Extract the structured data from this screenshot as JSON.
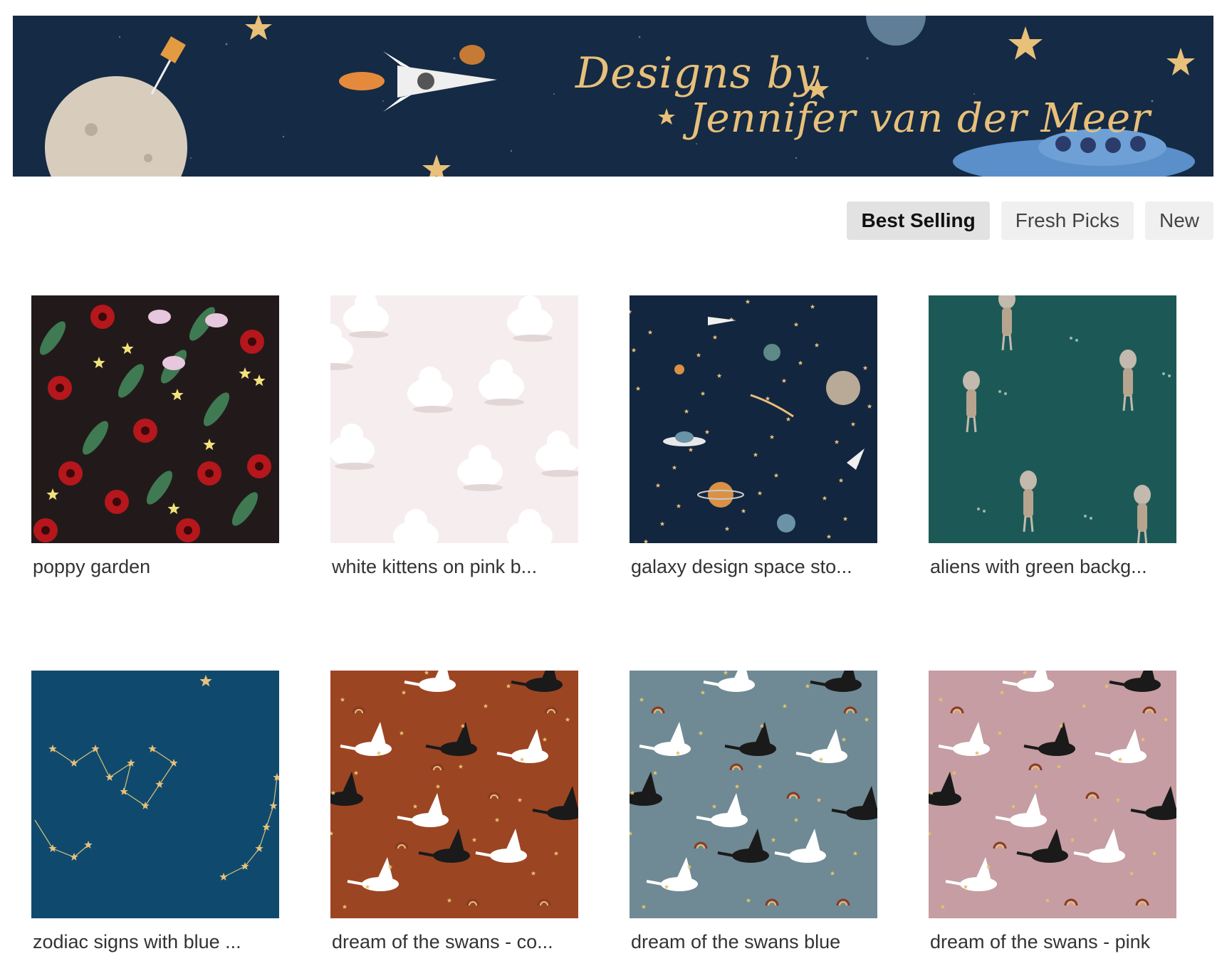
{
  "banner": {
    "line1": "Designs by",
    "line2": "Jennifer van der Meer"
  },
  "sort": {
    "options": [
      {
        "label": "Best Selling",
        "active": true
      },
      {
        "label": "Fresh Picks",
        "active": false
      },
      {
        "label": "New",
        "active": false
      }
    ]
  },
  "designs": [
    {
      "title": "poppy garden",
      "pattern": "floral",
      "bg": "#221a1a"
    },
    {
      "title": "white kittens on pink b...",
      "pattern": "kittens",
      "bg": "#f6eeee"
    },
    {
      "title": "galaxy design space sto...",
      "pattern": "galaxy",
      "bg": "#13263f"
    },
    {
      "title": "aliens with green backg...",
      "pattern": "aliens",
      "bg": "#1c5956"
    },
    {
      "title": "zodiac signs with blue ...",
      "pattern": "zodiac",
      "bg": "#0f4a6e"
    },
    {
      "title": "dream of the swans - co...",
      "pattern": "swans",
      "bg": "#9c4523"
    },
    {
      "title": "dream of the swans blue",
      "pattern": "swans",
      "bg": "#6f8a95"
    },
    {
      "title": "dream of the swans - pink",
      "pattern": "swans",
      "bg": "#c59da3"
    }
  ]
}
